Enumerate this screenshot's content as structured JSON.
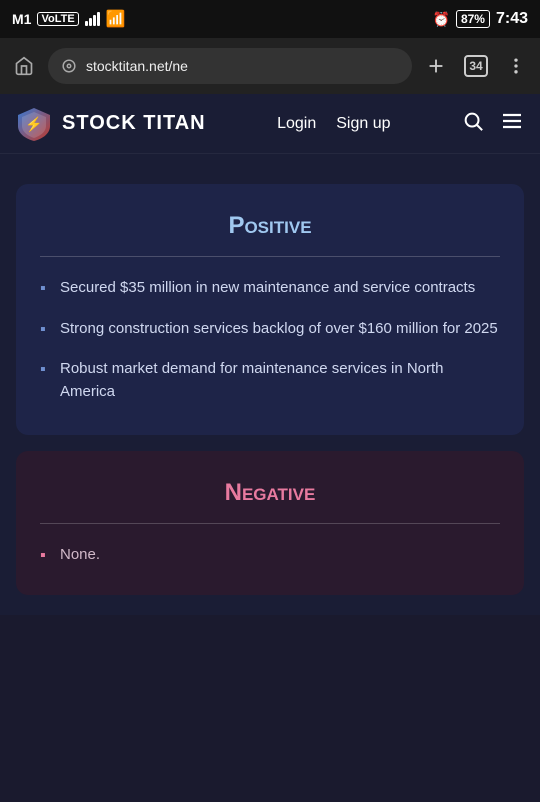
{
  "statusBar": {
    "carrier": "M1",
    "carrierType": "VoLTE",
    "signal": "signal",
    "wifi": "wifi",
    "alarm": "alarm",
    "battery": "87",
    "time": "7:43"
  },
  "browserBar": {
    "url": "stocktitan.net/ne",
    "tabCount": "34"
  },
  "nav": {
    "logoText": "STOCK TITAN",
    "loginLabel": "Login",
    "signupLabel": "Sign up"
  },
  "positive": {
    "title": "Positive",
    "items": [
      "Secured $35 million in new maintenance and service contracts",
      "Strong construction services backlog of over $160 million for 2025",
      "Robust market demand for maintenance services in North America"
    ]
  },
  "negative": {
    "title": "Negative",
    "items": [
      "None."
    ]
  }
}
